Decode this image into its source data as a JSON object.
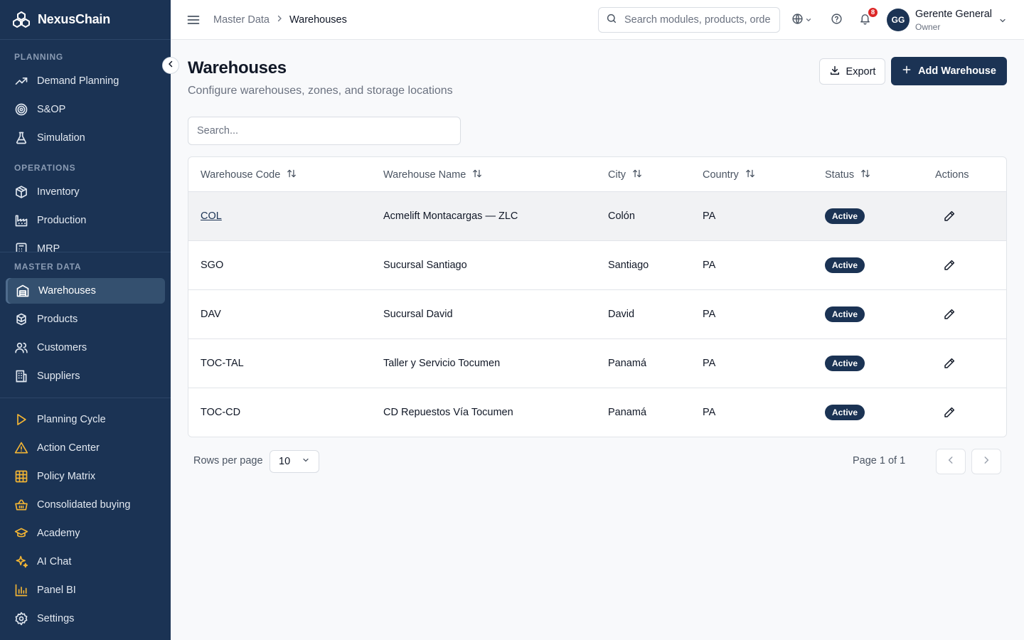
{
  "brand": {
    "name": "NexusChain"
  },
  "sidebar": {
    "sections": {
      "planning": "PLANNING",
      "operations": "OPERATIONS",
      "master_data": "MASTER DATA"
    },
    "items": {
      "demand_planning": "Demand Planning",
      "sop": "S&OP",
      "simulation": "Simulation",
      "inventory": "Inventory",
      "production": "Production",
      "mrp": "MRP",
      "warehouses": "Warehouses",
      "products": "Products",
      "customers": "Customers",
      "suppliers": "Suppliers",
      "planning_cycle": "Planning Cycle",
      "action_center": "Action Center",
      "policy_matrix": "Policy Matrix",
      "consolidated_buying": "Consolidated buying",
      "academy": "Academy",
      "ai_chat": "AI Chat",
      "panel_bi": "Panel BI",
      "settings": "Settings"
    },
    "icons": {
      "demand_planning": "trending-up-icon",
      "sop": "target-icon",
      "simulation": "flask-icon",
      "inventory": "package-icon",
      "production": "factory-icon",
      "mrp": "calculator-icon",
      "warehouses": "warehouse-icon",
      "products": "boxes-icon",
      "customers": "users-icon",
      "suppliers": "building-icon",
      "planning_cycle": "play-icon",
      "action_center": "warning-triangle-icon",
      "policy_matrix": "grid-icon",
      "consolidated_buying": "basket-icon",
      "academy": "graduation-cap-icon",
      "ai_chat": "sparkles-icon",
      "panel_bi": "bar-chart-icon",
      "settings": "gear-icon"
    }
  },
  "header": {
    "breadcrumb": {
      "parent": "Master Data",
      "current": "Warehouses"
    },
    "search_placeholder": "Search modules, products, orders...",
    "notifications_count": "8",
    "user": {
      "initials": "GG",
      "name": "Gerente General",
      "role": "Owner"
    }
  },
  "main": {
    "title": "Warehouses",
    "subtitle": "Configure warehouses, zones, and storage locations",
    "export_label": "Export",
    "add_label": "Add Warehouse",
    "search_placeholder": "Search...",
    "columns": {
      "code": "Warehouse Code",
      "name": "Warehouse Name",
      "city": "City",
      "country": "Country",
      "status": "Status",
      "actions": "Actions"
    },
    "rows": [
      {
        "code": "COL",
        "name": "Acmelift Montacargas — ZLC",
        "city": "Colón",
        "country": "PA",
        "status": "Active"
      },
      {
        "code": "SGO",
        "name": "Sucursal Santiago",
        "city": "Santiago",
        "country": "PA",
        "status": "Active"
      },
      {
        "code": "DAV",
        "name": "Sucursal David",
        "city": "David",
        "country": "PA",
        "status": "Active"
      },
      {
        "code": "TOC-TAL",
        "name": "Taller y Servicio Tocumen",
        "city": "Panamá",
        "country": "PA",
        "status": "Active"
      },
      {
        "code": "TOC-CD",
        "name": "CD Repuestos Vía Tocumen",
        "city": "Panamá",
        "country": "PA",
        "status": "Active"
      }
    ],
    "pagination": {
      "rows_per_page_label": "Rows per page",
      "rows_per_page_value": "10",
      "page_info": "Page 1 of 1"
    }
  },
  "colors": {
    "sidebar_bg": "#1b3354",
    "primary": "#1b3354",
    "accent_gold": "#f3b534",
    "badge_red": "#dc2626"
  }
}
